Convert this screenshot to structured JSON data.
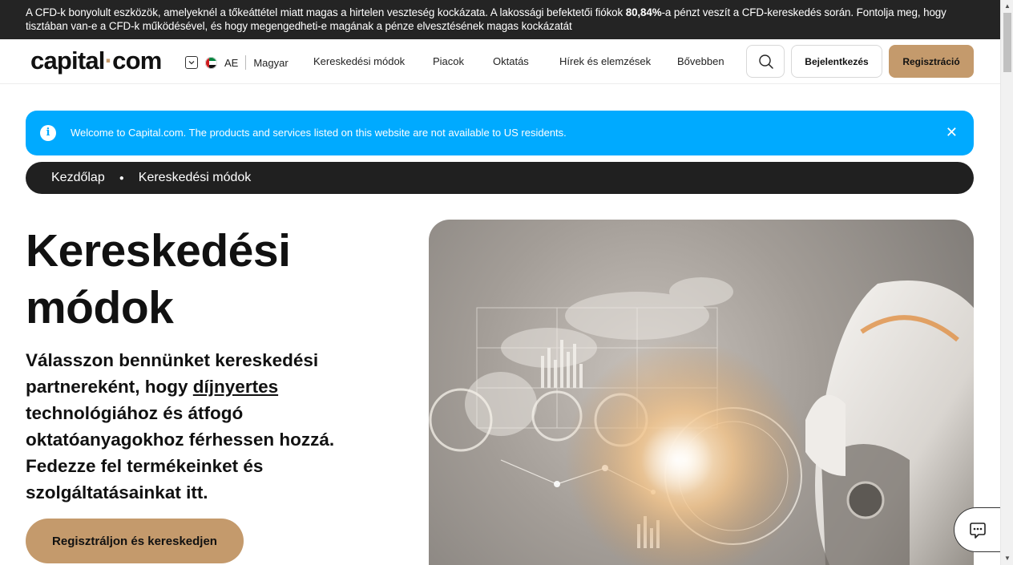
{
  "risk_banner": {
    "text_before": "A CFD-k bonyolult eszközök, amelyeknél a tőkeáttétel miatt magas a hirtelen veszteség kockázata. A lakossági befektetői fiókok ",
    "percent": "80,84%",
    "text_after": "-a pénzt veszít a CFD-kereskedés során. Fontolja meg, hogy tisztában van-e a CFD-k működésével, és hogy megengedheti-e magának a pénze elvesztésének magas kockázatát"
  },
  "header": {
    "logo_left": "capital",
    "logo_dot": "·",
    "logo_right": "com",
    "country_code": "AE",
    "language": "Magyar",
    "nav": [
      "Kereskedési módok",
      "Piacok",
      "Oktatás",
      "Hírek és elemzések",
      "Bővebben"
    ],
    "login_label": "Bejelentkezés",
    "register_label": "Regisztráció"
  },
  "info_bar": {
    "message": "Welcome to Capital.com. The products and services listed on this website are not available to US residents.",
    "close_symbol": "✕"
  },
  "breadcrumb": {
    "items": [
      "Kezdőlap",
      "Kereskedési módok"
    ]
  },
  "hero": {
    "title_line1": "Kereskedési",
    "title_line2": "módok",
    "text_before": "Válasszon bennünket kereskedési partnereként, hogy ",
    "text_link": "díjnyertes",
    "text_after": " technológiához és átfogó oktatóanyagokhoz férhessen hozzá. Fedezze fel termékeinket és szolgáltatásainkat itt.",
    "cta_label": "Regisztráljon és kereskedjen"
  },
  "colors": {
    "accent": "#c49a6c",
    "info_blue": "#00aaff",
    "dark": "#202020"
  },
  "icons": {
    "search": "search-icon",
    "info": "info-icon",
    "close": "close-icon",
    "chat": "chat-icon",
    "chevron": "chevron-down-icon",
    "flag": "uae-flag-icon"
  }
}
